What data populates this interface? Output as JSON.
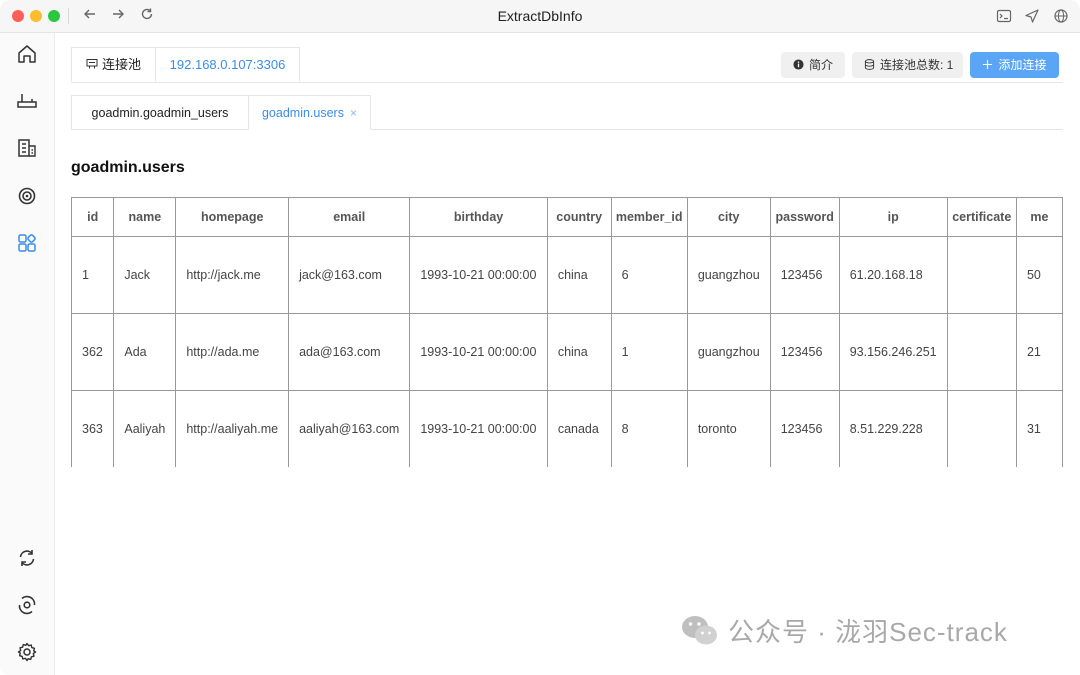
{
  "window": {
    "title": "ExtractDbInfo"
  },
  "top_tabs": [
    {
      "label": "连接池"
    },
    {
      "label": "192.168.0.107:3306"
    }
  ],
  "toolbar": {
    "intro_label": "简介",
    "pool_label": "连接池总数: 1",
    "add_label": "添加连接"
  },
  "sub_tabs": [
    {
      "label": "goadmin.goadmin_users"
    },
    {
      "label": "goadmin.users",
      "close": "×"
    }
  ],
  "page": {
    "title": "goadmin.users"
  },
  "table": {
    "columns": [
      "id",
      "name",
      "homepage",
      "email",
      "birthday",
      "country",
      "member_id",
      "city",
      "password",
      "ip",
      "certificate",
      "me"
    ],
    "rows": [
      [
        "1",
        "Jack",
        "http://jack.me",
        "jack@163.com",
        "1993-10-21 00:00:00",
        "china",
        "6",
        "guangzhou",
        "123456",
        "61.20.168.18",
        "",
        "50"
      ],
      [
        "362",
        "Ada",
        "http://ada.me",
        "ada@163.com",
        "1993-10-21 00:00:00",
        "china",
        "1",
        "guangzhou",
        "123456",
        "93.156.246.251",
        "",
        "21"
      ],
      [
        "363",
        "Aaliyah",
        "http://aaliyah.me",
        "aaliyah@163.com",
        "1993-10-21 00:00:00",
        "canada",
        "8",
        "toronto",
        "123456",
        "8.51.229.228",
        "",
        "31"
      ]
    ]
  },
  "watermark": {
    "text": "公众号 · 泷羽Sec-track"
  },
  "colors": {
    "accent": "#3b8ce8",
    "primary_button": "#5aa5f5"
  },
  "icons": {
    "sidebar": [
      "home-icon",
      "router-icon",
      "building-icon",
      "target-icon",
      "apps-icon",
      "sync-icon",
      "scan-icon",
      "settings-icon"
    ],
    "titlebar": [
      "back-icon",
      "forward-icon",
      "refresh-icon",
      "terminal-icon",
      "send-icon",
      "globe-icon"
    ]
  }
}
